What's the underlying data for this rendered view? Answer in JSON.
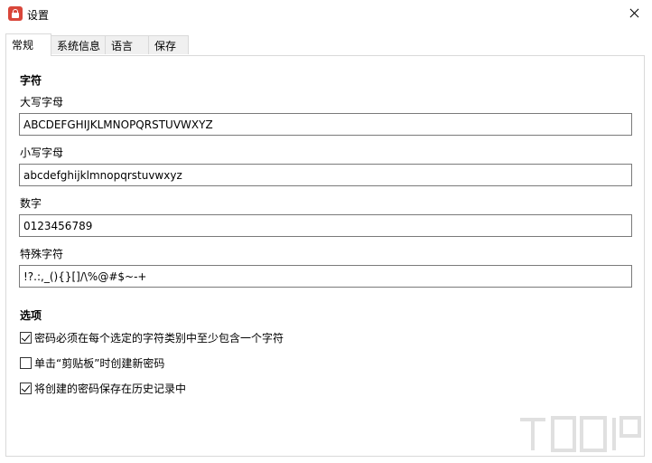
{
  "window": {
    "title": "设置"
  },
  "tabs": [
    {
      "label": "常规",
      "active": true
    },
    {
      "label": "系统信息",
      "active": false
    },
    {
      "label": "语言",
      "active": false
    },
    {
      "label": "保存",
      "active": false
    }
  ],
  "characters": {
    "heading": "字符",
    "uppercase": {
      "label": "大写字母",
      "value": "ABCDEFGHIJKLMNOPQRSTUVWXYZ"
    },
    "lowercase": {
      "label": "小写字母",
      "value": "abcdefghijklmnopqrstuvwxyz"
    },
    "digits": {
      "label": "数字",
      "value": "0123456789"
    },
    "special": {
      "label": "特殊字符",
      "value": "!?.:,_(){}[]/\\%@#$~-+"
    }
  },
  "options": {
    "heading": "选项",
    "items": [
      {
        "label": "密码必须在每个选定的字符类别中至少包含一个字符",
        "checked": true
      },
      {
        "label": "单击“剪贴板”时创建新密码",
        "checked": false
      },
      {
        "label": "将创建的密码保存在历史记录中",
        "checked": true
      }
    ]
  },
  "icons": {
    "app": "app-lock-icon",
    "close": "close-icon"
  },
  "colors": {
    "app_icon": "#d9463a",
    "border": "#d9d9d9",
    "input_border": "#7a7a7a"
  }
}
